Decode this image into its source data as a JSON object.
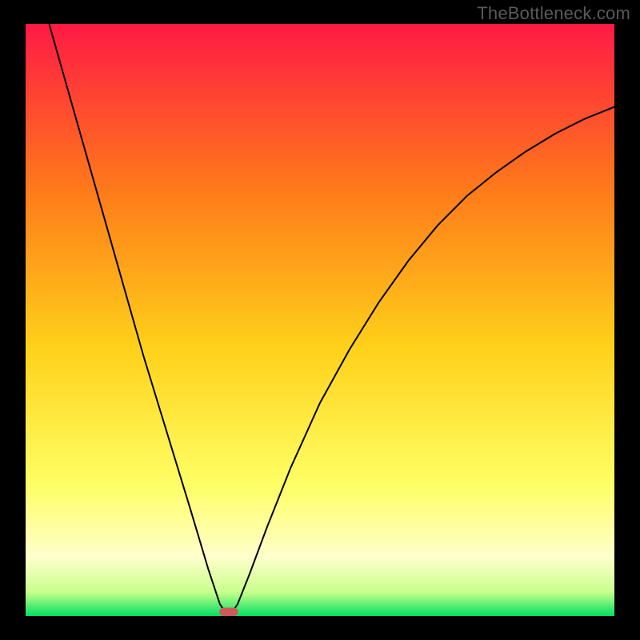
{
  "watermark": "TheBottleneck.com",
  "chart_data": {
    "type": "line",
    "title": "",
    "xlabel": "",
    "ylabel": "",
    "xlim": [
      0,
      100
    ],
    "ylim": [
      0,
      100
    ],
    "background_gradient": {
      "top": "#ff1a44",
      "upper_mid": "#ff7a1a",
      "mid": "#ffd21a",
      "lower_mid": "#ffff66",
      "band": "#ffffcc",
      "bottom": "#00e060"
    },
    "series": [
      {
        "name": "bottleneck-curve",
        "stroke": "#000000",
        "stroke_width": 2,
        "points": [
          {
            "x": 4,
            "y": 100
          },
          {
            "x": 8,
            "y": 86
          },
          {
            "x": 12,
            "y": 72
          },
          {
            "x": 16,
            "y": 58
          },
          {
            "x": 20,
            "y": 44
          },
          {
            "x": 24,
            "y": 31
          },
          {
            "x": 28,
            "y": 18
          },
          {
            "x": 31,
            "y": 8
          },
          {
            "x": 33,
            "y": 2
          },
          {
            "x": 34,
            "y": 0.5
          },
          {
            "x": 35,
            "y": 0.5
          },
          {
            "x": 36,
            "y": 2
          },
          {
            "x": 38,
            "y": 7
          },
          {
            "x": 41,
            "y": 15
          },
          {
            "x": 45,
            "y": 25
          },
          {
            "x": 50,
            "y": 36
          },
          {
            "x": 55,
            "y": 45
          },
          {
            "x": 60,
            "y": 53
          },
          {
            "x": 65,
            "y": 60
          },
          {
            "x": 70,
            "y": 66
          },
          {
            "x": 75,
            "y": 71
          },
          {
            "x": 80,
            "y": 75
          },
          {
            "x": 85,
            "y": 78.5
          },
          {
            "x": 90,
            "y": 81.5
          },
          {
            "x": 95,
            "y": 84
          },
          {
            "x": 100,
            "y": 86
          }
        ]
      }
    ],
    "marker": {
      "name": "optimal-point",
      "shape": "rounded-rect",
      "x": 34.5,
      "y": 0.7,
      "width": 3.2,
      "height": 1.4,
      "fill": "#cc5a5a"
    }
  }
}
